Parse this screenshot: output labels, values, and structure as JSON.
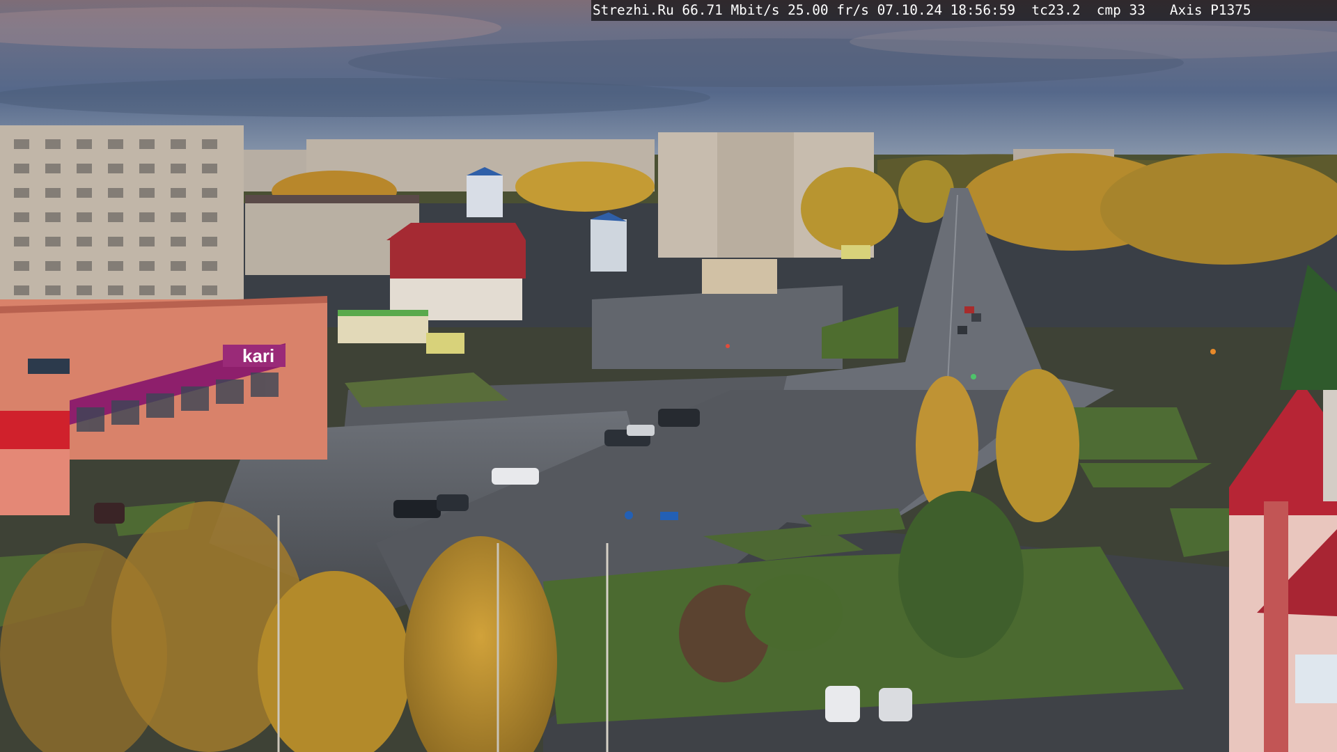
{
  "overlay": {
    "camera_info": "Strezhi.Ru 66.71 Mbit/s 25.00 fr/s 07.10.24 18:56:59  tc23.2  cmp 33   Axis P1375"
  },
  "signage": {
    "store_brand": "kari"
  },
  "colors": {
    "sky_top": "#7d6f78",
    "sky_mid": "#5d6f8c",
    "sky_low": "#8e9cad",
    "asphalt": "#4a4d52",
    "grass": "#4e6a33",
    "foliage_yellow": "#b38a2a",
    "brick_orange": "#d9826a",
    "roof_red": "#a3252e",
    "kari_magenta": "#8e1f6c"
  }
}
